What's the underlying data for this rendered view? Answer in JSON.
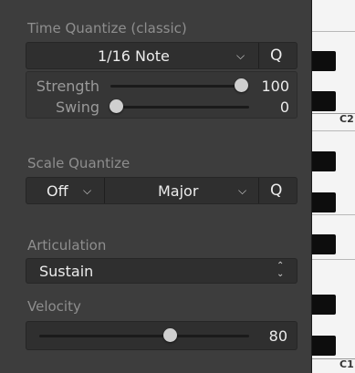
{
  "time_quantize": {
    "title": "Time Quantize (classic)",
    "note_value": "1/16 Note",
    "q_label": "Q",
    "strength": {
      "label": "Strength",
      "value": "100",
      "level": 1.0
    },
    "swing": {
      "label": "Swing",
      "value": "0",
      "level": 0.0
    }
  },
  "scale_quantize": {
    "title": "Scale Quantize",
    "root": "Off",
    "scale": "Major",
    "q_label": "Q"
  },
  "articulation": {
    "title": "Articulation",
    "value": "Sustain"
  },
  "velocity": {
    "title": "Velocity",
    "value": "80",
    "level": 0.63
  },
  "keyboard": {
    "octave_labels": [
      "C2",
      "C1"
    ]
  },
  "icons": {
    "dropdown": "chevron-down-icon",
    "stepper": "up-down-chevron-icon"
  },
  "colors": {
    "panel": "#3d3d3d",
    "control": "#2f2f2f",
    "title_text": "#8e8e8e",
    "value_text": "#ececec",
    "thumb": "#cfcfcf"
  }
}
